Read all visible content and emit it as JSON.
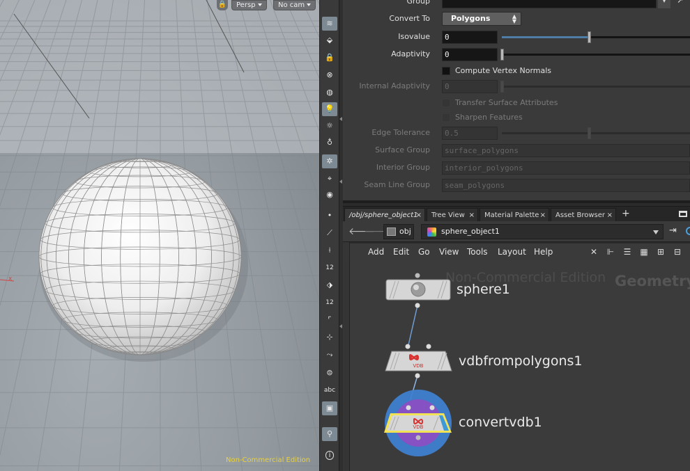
{
  "viewport": {
    "lock_icon": "lock-icon",
    "camera_mode": "Persp",
    "camera_name": "No cam",
    "watermark": "Non-Commercial Edition",
    "axis_label": "x"
  },
  "shelf": {
    "icons": [
      "display-options-icon",
      "select-icon",
      "lock-camera-icon",
      "snap-icon",
      "shading-icon",
      "light-icon",
      "headlight-icon",
      "lightbulb-add-icon",
      "ghost-icon",
      "visualize-icon",
      "eye-icon",
      "point-icon",
      "brush-icon",
      "pin-icon",
      "vertex-numbers-icon",
      "paint-icon",
      "primitive-numbers-icon",
      "corner-icon",
      "transform-icon",
      "normals-icon",
      "template-icon",
      "text-icon",
      "background-image-icon",
      "location-icon",
      "info-icon"
    ],
    "labels": {
      "vertex_numbers": "12",
      "primitive_numbers": "12",
      "text_tool": "abc",
      "info": "i"
    }
  },
  "parameters": {
    "group": {
      "label": "Group",
      "value": ""
    },
    "convert_to": {
      "label": "Convert To",
      "value": "Polygons"
    },
    "isovalue": {
      "label": "Isovalue",
      "value": "0",
      "fraction": 0.5
    },
    "adaptivity": {
      "label": "Adaptivity",
      "value": "0",
      "fraction": 0.0
    },
    "compute_vertex_normals": {
      "label": "Compute Vertex Normals",
      "checked": false
    },
    "internal_adaptivity": {
      "label": "Internal Adaptivity",
      "value": "0",
      "fraction": 0.0
    },
    "transfer_surface_attributes": {
      "label": "Transfer Surface Attributes",
      "checked": false
    },
    "sharpen_features": {
      "label": "Sharpen Features",
      "checked": false
    },
    "edge_tolerance": {
      "label": "Edge Tolerance",
      "value": "0.5",
      "fraction": 0.5
    },
    "surface_group": {
      "label": "Surface Group",
      "value": "surface_polygons"
    },
    "interior_group": {
      "label": "Interior Group",
      "value": "interior_polygons"
    },
    "seam_line_group": {
      "label": "Seam Line Group",
      "value": "seam_polygons"
    }
  },
  "tabs": [
    {
      "label": "/obj/sphere_object1",
      "active": true
    },
    {
      "label": "Tree View",
      "active": false
    },
    {
      "label": "Material Palette",
      "active": false
    },
    {
      "label": "Asset Browser",
      "active": false
    }
  ],
  "tab_close": "×",
  "tab_add": "+",
  "path": {
    "root": "obj",
    "object": "sphere_object1"
  },
  "network_menu": [
    "Add",
    "Edit",
    "Go",
    "View",
    "Tools",
    "Layout",
    "Help"
  ],
  "network_toolbar_icons": [
    "wrench-icon",
    "tree-icon",
    "list-icon",
    "color-palette-icon",
    "grid-icon",
    "layout-icon"
  ],
  "network": {
    "watermark": "Non-Commercial Edition",
    "context_label": "Geometry",
    "nodes": [
      {
        "name": "sphere1",
        "icon": "sphere-icon"
      },
      {
        "name": "vdbfrompolygons1",
        "icon": "vdb-icon",
        "badge": "VDB"
      },
      {
        "name": "convertvdb1",
        "icon": "vdb-icon",
        "badge": "VDB",
        "selected": true,
        "display": true
      }
    ]
  },
  "colors": {
    "display_flag": "#3f7fd0",
    "render_flag": "#8a4fc2",
    "selected_outline": "#f2e255",
    "slider_fill": "#4e7da6",
    "watermark_yellow": "#e9d23a"
  }
}
